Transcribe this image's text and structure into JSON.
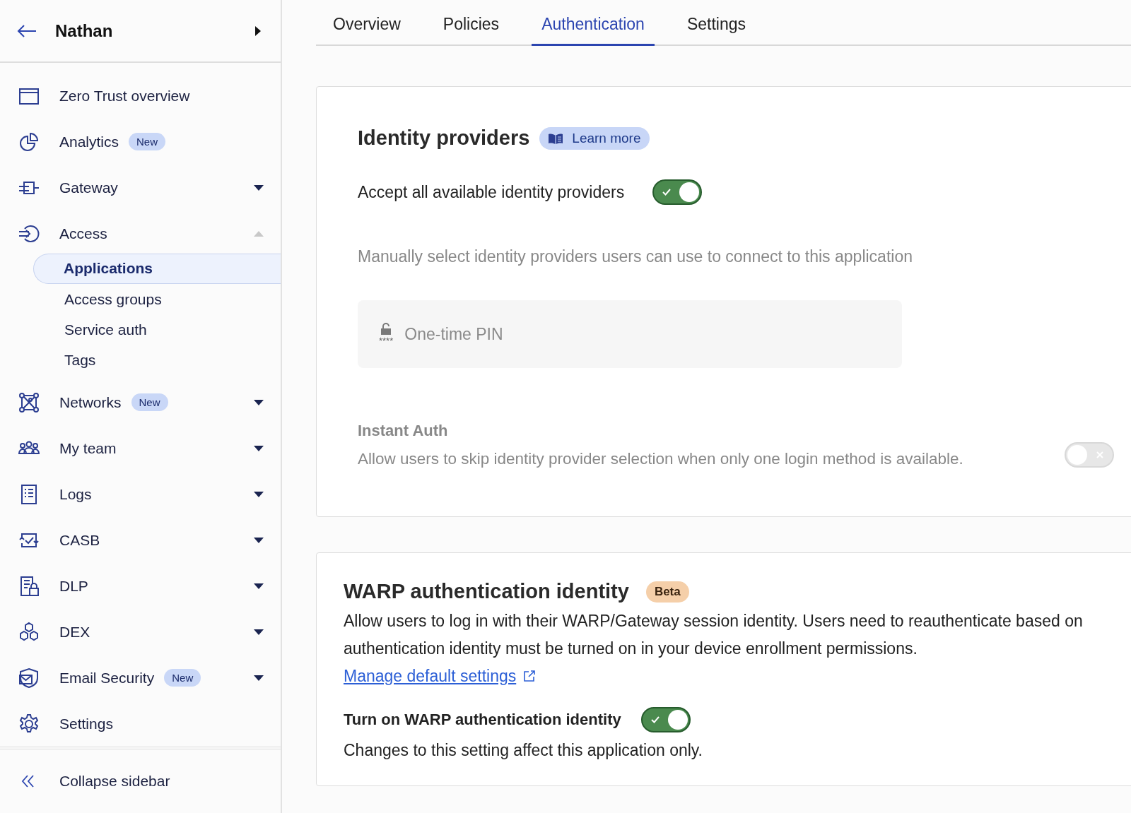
{
  "sidebar": {
    "account": {
      "name": "Nathan"
    },
    "items": [
      {
        "label": "Zero Trust overview"
      },
      {
        "label": "Analytics",
        "badge": "New"
      },
      {
        "label": "Gateway",
        "expanded": false
      },
      {
        "label": "Access",
        "expanded": true,
        "children": [
          {
            "label": "Applications",
            "selected": true
          },
          {
            "label": "Access groups",
            "selected": false
          },
          {
            "label": "Service auth",
            "selected": false
          },
          {
            "label": "Tags",
            "selected": false
          }
        ]
      },
      {
        "label": "Networks",
        "badge": "New",
        "expanded": false
      },
      {
        "label": "My team",
        "expanded": false
      },
      {
        "label": "Logs",
        "expanded": false
      },
      {
        "label": "CASB",
        "expanded": false
      },
      {
        "label": "DLP",
        "expanded": false
      },
      {
        "label": "DEX",
        "expanded": false
      },
      {
        "label": "Email Security",
        "badge": "New",
        "expanded": false
      },
      {
        "label": "Settings"
      }
    ],
    "collapse": "Collapse sidebar"
  },
  "tabs": [
    {
      "label": "Overview",
      "selected": false
    },
    {
      "label": "Policies",
      "selected": false
    },
    {
      "label": "Authentication",
      "selected": true
    },
    {
      "label": "Settings",
      "selected": false
    }
  ],
  "identity_providers": {
    "title": "Identity providers",
    "learn_more": "Learn more",
    "accept_all": {
      "label": "Accept all available identity providers",
      "checked": true
    },
    "manual_hint": "Manually select identity providers users can use to connect to this application",
    "providers": [
      {
        "name": "One-time PIN",
        "icon_text": "****",
        "disabled": true
      }
    ],
    "instant_auth": {
      "title": "Instant Auth",
      "description": "Allow users to skip identity provider selection when only one login method is available.",
      "checked": false,
      "disabled": true
    }
  },
  "warp": {
    "title": "WARP authentication identity",
    "badge": "Beta",
    "description": [
      "Allow users to log in with their WARP/Gateway session identity. Users need to reauthenticate based on",
      "authentication identity must be turned on in your device enrollment permissions."
    ],
    "link": "Manage default settings",
    "toggle": {
      "label": "Turn on WARP authentication identity",
      "checked": true
    },
    "note": "Changes to this setting affect this application only."
  }
}
